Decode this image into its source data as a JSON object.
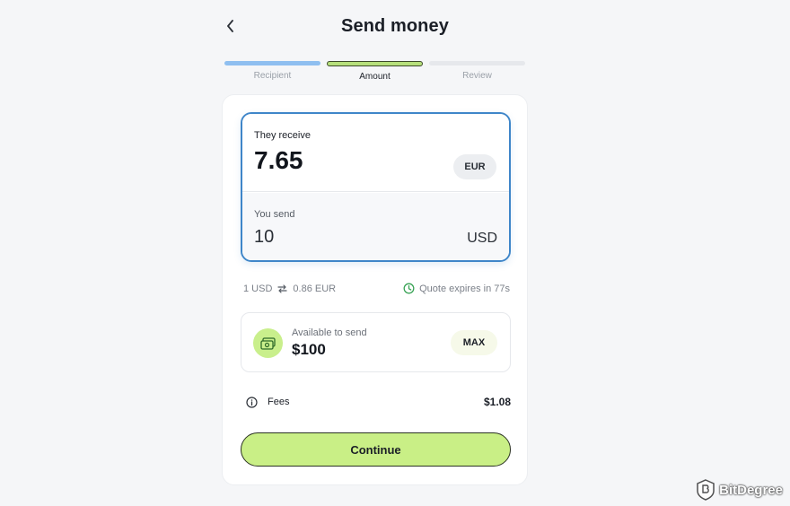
{
  "header": {
    "title": "Send money",
    "back_icon": "chevron-left-icon"
  },
  "stepper": {
    "steps": [
      {
        "label": "Recipient",
        "state": "done"
      },
      {
        "label": "Amount",
        "state": "active"
      },
      {
        "label": "Review",
        "state": "pending"
      }
    ]
  },
  "receive": {
    "label": "They receive",
    "amount": "7.65",
    "currency": "EUR"
  },
  "send": {
    "label": "You send",
    "amount": "10",
    "currency": "USD"
  },
  "rate": {
    "from": "1 USD",
    "to": "0.86 EUR",
    "icon": "swap-icon"
  },
  "quote": {
    "text": "Quote expires in 77s",
    "icon": "clock-icon"
  },
  "available": {
    "label": "Available to send",
    "value": "$100",
    "max_label": "MAX",
    "icon": "wallet-icon"
  },
  "fees": {
    "label": "Fees",
    "value": "$1.08",
    "icon": "info-icon"
  },
  "continue_label": "Continue",
  "watermark": {
    "text": "BitDegree"
  },
  "colors": {
    "accent_green": "#c9ef86",
    "focus_blue": "#3f86c9",
    "step_done": "#8fbff0",
    "quote_green": "#3aa356"
  }
}
